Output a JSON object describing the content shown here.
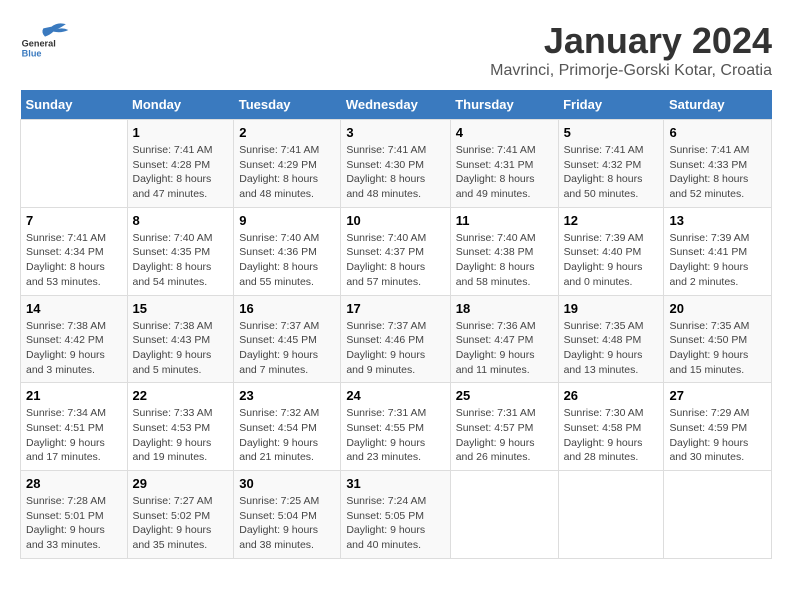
{
  "header": {
    "logo_line1": "General",
    "logo_line2": "Blue",
    "title": "January 2024",
    "subtitle": "Mavrinci, Primorje-Gorski Kotar, Croatia"
  },
  "weekdays": [
    "Sunday",
    "Monday",
    "Tuesday",
    "Wednesday",
    "Thursday",
    "Friday",
    "Saturday"
  ],
  "weeks": [
    [
      {
        "day": "",
        "info": ""
      },
      {
        "day": "1",
        "info": "Sunrise: 7:41 AM\nSunset: 4:28 PM\nDaylight: 8 hours\nand 47 minutes."
      },
      {
        "day": "2",
        "info": "Sunrise: 7:41 AM\nSunset: 4:29 PM\nDaylight: 8 hours\nand 48 minutes."
      },
      {
        "day": "3",
        "info": "Sunrise: 7:41 AM\nSunset: 4:30 PM\nDaylight: 8 hours\nand 48 minutes."
      },
      {
        "day": "4",
        "info": "Sunrise: 7:41 AM\nSunset: 4:31 PM\nDaylight: 8 hours\nand 49 minutes."
      },
      {
        "day": "5",
        "info": "Sunrise: 7:41 AM\nSunset: 4:32 PM\nDaylight: 8 hours\nand 50 minutes."
      },
      {
        "day": "6",
        "info": "Sunrise: 7:41 AM\nSunset: 4:33 PM\nDaylight: 8 hours\nand 52 minutes."
      }
    ],
    [
      {
        "day": "7",
        "info": "Sunrise: 7:41 AM\nSunset: 4:34 PM\nDaylight: 8 hours\nand 53 minutes."
      },
      {
        "day": "8",
        "info": "Sunrise: 7:40 AM\nSunset: 4:35 PM\nDaylight: 8 hours\nand 54 minutes."
      },
      {
        "day": "9",
        "info": "Sunrise: 7:40 AM\nSunset: 4:36 PM\nDaylight: 8 hours\nand 55 minutes."
      },
      {
        "day": "10",
        "info": "Sunrise: 7:40 AM\nSunset: 4:37 PM\nDaylight: 8 hours\nand 57 minutes."
      },
      {
        "day": "11",
        "info": "Sunrise: 7:40 AM\nSunset: 4:38 PM\nDaylight: 8 hours\nand 58 minutes."
      },
      {
        "day": "12",
        "info": "Sunrise: 7:39 AM\nSunset: 4:40 PM\nDaylight: 9 hours\nand 0 minutes."
      },
      {
        "day": "13",
        "info": "Sunrise: 7:39 AM\nSunset: 4:41 PM\nDaylight: 9 hours\nand 2 minutes."
      }
    ],
    [
      {
        "day": "14",
        "info": "Sunrise: 7:38 AM\nSunset: 4:42 PM\nDaylight: 9 hours\nand 3 minutes."
      },
      {
        "day": "15",
        "info": "Sunrise: 7:38 AM\nSunset: 4:43 PM\nDaylight: 9 hours\nand 5 minutes."
      },
      {
        "day": "16",
        "info": "Sunrise: 7:37 AM\nSunset: 4:45 PM\nDaylight: 9 hours\nand 7 minutes."
      },
      {
        "day": "17",
        "info": "Sunrise: 7:37 AM\nSunset: 4:46 PM\nDaylight: 9 hours\nand 9 minutes."
      },
      {
        "day": "18",
        "info": "Sunrise: 7:36 AM\nSunset: 4:47 PM\nDaylight: 9 hours\nand 11 minutes."
      },
      {
        "day": "19",
        "info": "Sunrise: 7:35 AM\nSunset: 4:48 PM\nDaylight: 9 hours\nand 13 minutes."
      },
      {
        "day": "20",
        "info": "Sunrise: 7:35 AM\nSunset: 4:50 PM\nDaylight: 9 hours\nand 15 minutes."
      }
    ],
    [
      {
        "day": "21",
        "info": "Sunrise: 7:34 AM\nSunset: 4:51 PM\nDaylight: 9 hours\nand 17 minutes."
      },
      {
        "day": "22",
        "info": "Sunrise: 7:33 AM\nSunset: 4:53 PM\nDaylight: 9 hours\nand 19 minutes."
      },
      {
        "day": "23",
        "info": "Sunrise: 7:32 AM\nSunset: 4:54 PM\nDaylight: 9 hours\nand 21 minutes."
      },
      {
        "day": "24",
        "info": "Sunrise: 7:31 AM\nSunset: 4:55 PM\nDaylight: 9 hours\nand 23 minutes."
      },
      {
        "day": "25",
        "info": "Sunrise: 7:31 AM\nSunset: 4:57 PM\nDaylight: 9 hours\nand 26 minutes."
      },
      {
        "day": "26",
        "info": "Sunrise: 7:30 AM\nSunset: 4:58 PM\nDaylight: 9 hours\nand 28 minutes."
      },
      {
        "day": "27",
        "info": "Sunrise: 7:29 AM\nSunset: 4:59 PM\nDaylight: 9 hours\nand 30 minutes."
      }
    ],
    [
      {
        "day": "28",
        "info": "Sunrise: 7:28 AM\nSunset: 5:01 PM\nDaylight: 9 hours\nand 33 minutes."
      },
      {
        "day": "29",
        "info": "Sunrise: 7:27 AM\nSunset: 5:02 PM\nDaylight: 9 hours\nand 35 minutes."
      },
      {
        "day": "30",
        "info": "Sunrise: 7:25 AM\nSunset: 5:04 PM\nDaylight: 9 hours\nand 38 minutes."
      },
      {
        "day": "31",
        "info": "Sunrise: 7:24 AM\nSunset: 5:05 PM\nDaylight: 9 hours\nand 40 minutes."
      },
      {
        "day": "",
        "info": ""
      },
      {
        "day": "",
        "info": ""
      },
      {
        "day": "",
        "info": ""
      }
    ]
  ]
}
